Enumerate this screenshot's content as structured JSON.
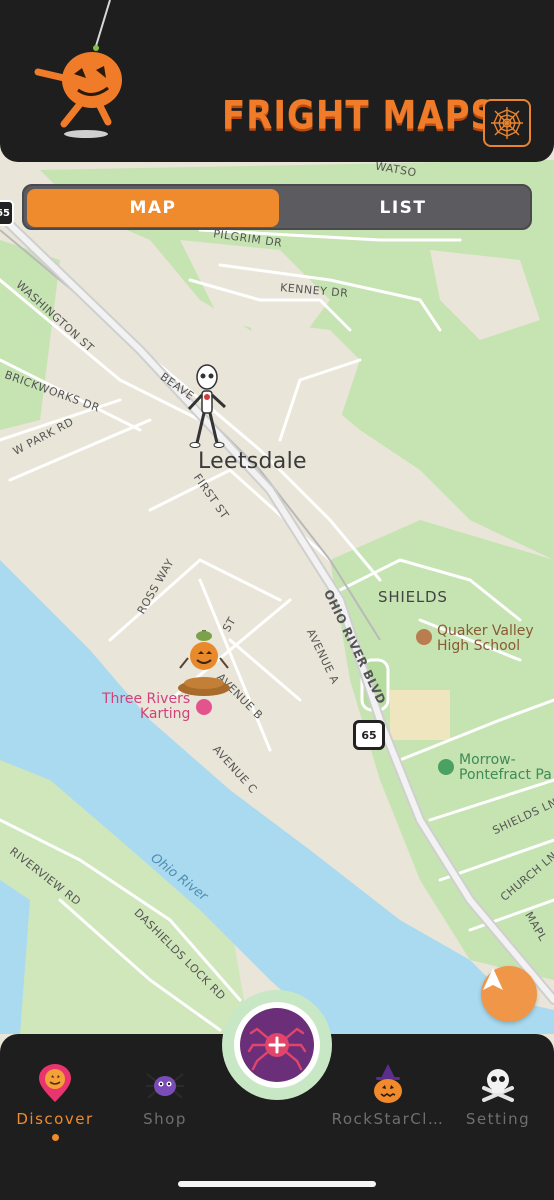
{
  "header": {
    "app_title": "FRIGHT MAPS"
  },
  "view_toggle": {
    "map_label": "MAP",
    "list_label": "LIST",
    "selected": "MAP"
  },
  "map": {
    "town": "Leetsdale",
    "neighborhood": "SHIELDS",
    "streets": [
      "WATSO",
      "PILGRIM DR",
      "KENNEY DR",
      "WASHINGTON ST",
      "BRICKWORKS DR",
      "W PARK RD",
      "BEAVE",
      "FIRST ST",
      "ROSS WAY",
      "ST",
      "AVENUE B",
      "AVENUE C",
      "OHIO RIVER BLVD",
      "AVENUE A",
      "RIVERVIEW RD",
      "DASHIELDS LOCK RD",
      "SHIELDS LN",
      "CHURCH LN",
      "MAPL"
    ],
    "water": "Ohio River",
    "route_shields": [
      "65",
      "65"
    ],
    "pois": [
      {
        "name_line1": "Quaker Valley",
        "name_line2": "High School"
      },
      {
        "name_line1": "Three Rivers",
        "name_line2": "Karting"
      },
      {
        "name_line1": "Morrow-",
        "name_line2": "Pontefract Pa"
      }
    ],
    "colors": {
      "land": "#e9e5d8",
      "park": "#c6e3b2",
      "water": "#a9daf0",
      "road": "#ffffff",
      "highway": "#c9c9c9"
    }
  },
  "markers": [
    {
      "icon": "skeleton-marker-icon"
    },
    {
      "icon": "pumpkin-scarecrow-marker-icon"
    }
  ],
  "tabbar": {
    "tabs": [
      {
        "label": "Discover",
        "icon": "pumpkin-pin-icon",
        "active": true
      },
      {
        "label": "Shop",
        "icon": "spider-icon",
        "active": false
      },
      {
        "label": "RockStarCl…",
        "icon": "witch-pumpkin-icon",
        "active": false
      },
      {
        "label": "Setting",
        "icon": "skull-crossbones-icon",
        "active": false
      }
    ],
    "center_button_icon": "spider-add-icon"
  },
  "theme": {
    "accent": "#ef8b2c",
    "header_bg": "#1e1e1e",
    "segment_bg": "#5b5b60"
  }
}
